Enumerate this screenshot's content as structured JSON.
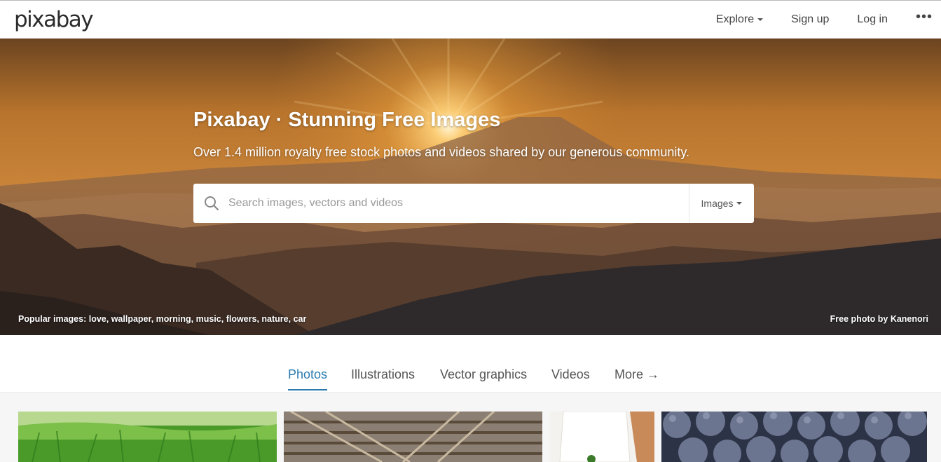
{
  "header": {
    "logo": "pixabay",
    "nav": {
      "explore": "Explore",
      "signup": "Sign up",
      "login": "Log in",
      "more": "•••"
    }
  },
  "hero": {
    "title": "Pixabay · Stunning Free Images",
    "subtitle": "Over 1.4 million royalty free stock photos and videos shared by our generous community.",
    "search": {
      "placeholder": "Search images, vectors and videos",
      "value": "",
      "type_label": "Images"
    },
    "popular": {
      "label": "Popular images:",
      "tags": [
        "love",
        "wallpaper",
        "morning",
        "music",
        "flowers",
        "nature",
        "car"
      ]
    },
    "credit": {
      "prefix": "Free photo by",
      "author": "Kanenori"
    }
  },
  "tabs": [
    "Photos",
    "Illustrations",
    "Vector graphics",
    "Videos",
    "More →"
  ],
  "active_tab": "Photos",
  "colors": {
    "accent": "#2a7ab0",
    "hero_sky": "#c8782a"
  },
  "thumbnails": [
    "grass",
    "railway tracks",
    "wedding dress",
    "blueberries"
  ]
}
